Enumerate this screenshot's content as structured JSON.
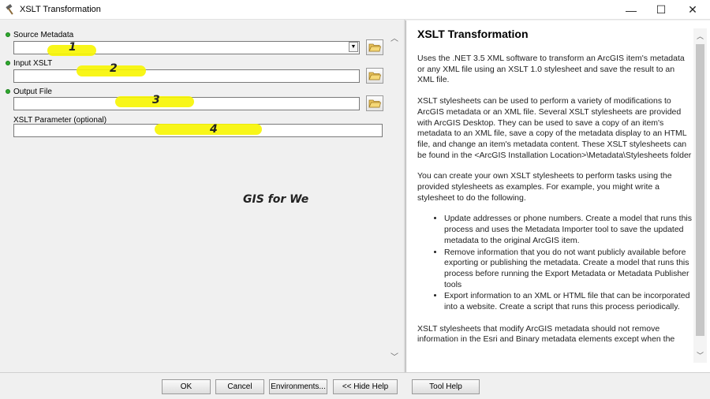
{
  "window": {
    "title": "XSLT Transformation",
    "minimize_glyph": "—",
    "maximize_glyph": "☐",
    "close_glyph": "✕",
    "icon": "hammer-icon"
  },
  "parameters": [
    {
      "label": "Source Metadata",
      "required": true,
      "value": "",
      "has_dropdown": true,
      "has_browse": true
    },
    {
      "label": "Input XSLT",
      "required": true,
      "value": "",
      "has_dropdown": false,
      "has_browse": true
    },
    {
      "label": "Output File",
      "required": true,
      "value": "",
      "has_dropdown": false,
      "has_browse": true
    },
    {
      "label": "XSLT Parameter (optional)",
      "required": false,
      "value": "",
      "has_dropdown": false,
      "has_browse": false
    }
  ],
  "annotations": {
    "numbers": [
      "1",
      "2",
      "3",
      "4"
    ],
    "highlight_color": "#f7f500",
    "watermark": "GIS for We"
  },
  "help": {
    "title": "XSLT Transformation",
    "paragraphs": [
      "Uses the .NET 3.5 XML software to transform an ArcGIS item's metadata or any XML file using an XSLT 1.0 stylesheet and save the result to an XML file.",
      "XSLT stylesheets can be used to perform a variety of modifications to ArcGIS metadata or an XML file. Several XSLT stylesheets are provided with ArcGIS Desktop. They can be used to save a copy of an item's metadata to an XML file, save a copy of the metadata display to an HTML file, and change an item's metadata content. These XSLT stylesheets can be found in the <ArcGIS Installation Location>\\Metadata\\Stylesheets folder",
      "You can create your own XSLT stylesheets to perform tasks using the provided stylesheets as examples. For example, you might write a stylesheet to do the following."
    ],
    "bullets": [
      "Update addresses or phone numbers. Create a model that runs this process and uses the Metadata Importer tool to save the updated metadata to the original ArcGIS item.",
      "Remove information that you do not want publicly available before exporting or publishing the metadata. Create a model that runs this process before running the Export Metadata or Metadata Publisher tools",
      "Export information to an XML or HTML file that can be incorporated into a website. Create a script that runs this process periodically."
    ],
    "closing": "XSLT stylesheets that modify ArcGIS metadata should not remove information in the Esri and Binary metadata elements except when the"
  },
  "buttons": {
    "ok": "OK",
    "cancel": "Cancel",
    "environments": "Environments...",
    "hide_help": "<< Hide Help",
    "tool_help": "Tool Help"
  },
  "colors": {
    "required_dot": "#2eaa2e",
    "window_bg": "#f0f0f0",
    "help_bg": "#ffffff"
  }
}
